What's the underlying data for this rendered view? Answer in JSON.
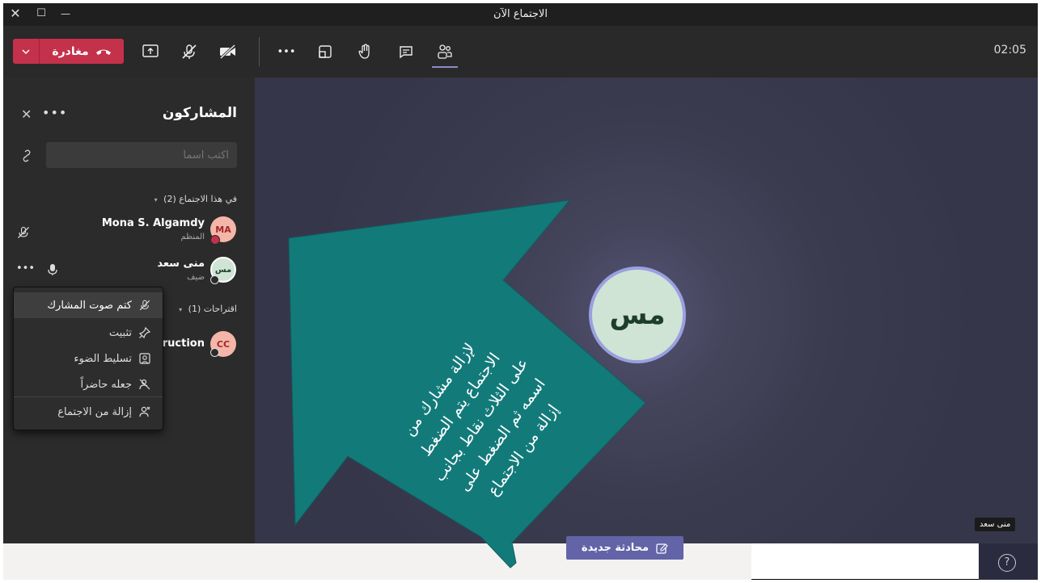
{
  "window": {
    "title": "الاجتماع الآن",
    "close_glyph": "✕",
    "maximize_glyph": "☐",
    "minimize_glyph": "—"
  },
  "toolbar": {
    "leave_label": "مغادرة",
    "leave_color": "#c4314b",
    "accent_color": "#6264a7",
    "timer": "02:05",
    "more_glyph": "•••",
    "icons": [
      "share-tray-icon",
      "mic-off-icon",
      "camera-off-icon",
      "more-actions-icon",
      "room-view-icon",
      "raise-hand-icon",
      "chat-icon",
      "people-icon"
    ]
  },
  "panel": {
    "title": "المشاركون",
    "more_glyph": "•••",
    "close_glyph": "✕",
    "search_placeholder": "اكتب اسماً",
    "section_in_meeting": "في هذا الاجتماع (2)",
    "section_suggestions": "اقتراحات (1)",
    "participants": [
      {
        "name": "Mona S. Algamdy",
        "role": "المنظم",
        "initials": "MA",
        "avatar_color": "#f4b6a8",
        "initials_color": "#a4262c"
      },
      {
        "name": "منى سعد",
        "role": "ضيف",
        "initials": "مس",
        "avatar_color": "#cfe4d4",
        "initials_color": "#1e3d2a"
      }
    ],
    "suggestion": {
      "name": "struction",
      "initials": "CC",
      "avatar_color": "#f4b6a8",
      "initials_color": "#a4262c"
    },
    "more_glyph_row": "•••"
  },
  "context_menu": {
    "items": [
      {
        "label": "كتم صوت المشارك",
        "icon": "mic-off-icon"
      },
      {
        "label": "تثبيت",
        "icon": "pin-icon"
      },
      {
        "label": "تسليط الضوء",
        "icon": "spotlight-icon"
      },
      {
        "label": "جعله حاضراً",
        "icon": "attendee-icon"
      },
      {
        "label": "إزالة من الاجتماع",
        "icon": "remove-person-icon"
      }
    ]
  },
  "stage": {
    "avatar_initials": "مس",
    "name_tag": "منى سعد"
  },
  "callout": {
    "text_lines": [
      "لإزالة مشارك من",
      "الاجتماع يتم الضغط",
      "على الثلاث نقاط بجانب",
      "اسمه ثم الضغط على",
      "إزالة من الاجتماع"
    ],
    "color": "#137a7a"
  },
  "bottom": {
    "new_chat_label": "محادثة جديدة",
    "help_glyph": "?"
  }
}
